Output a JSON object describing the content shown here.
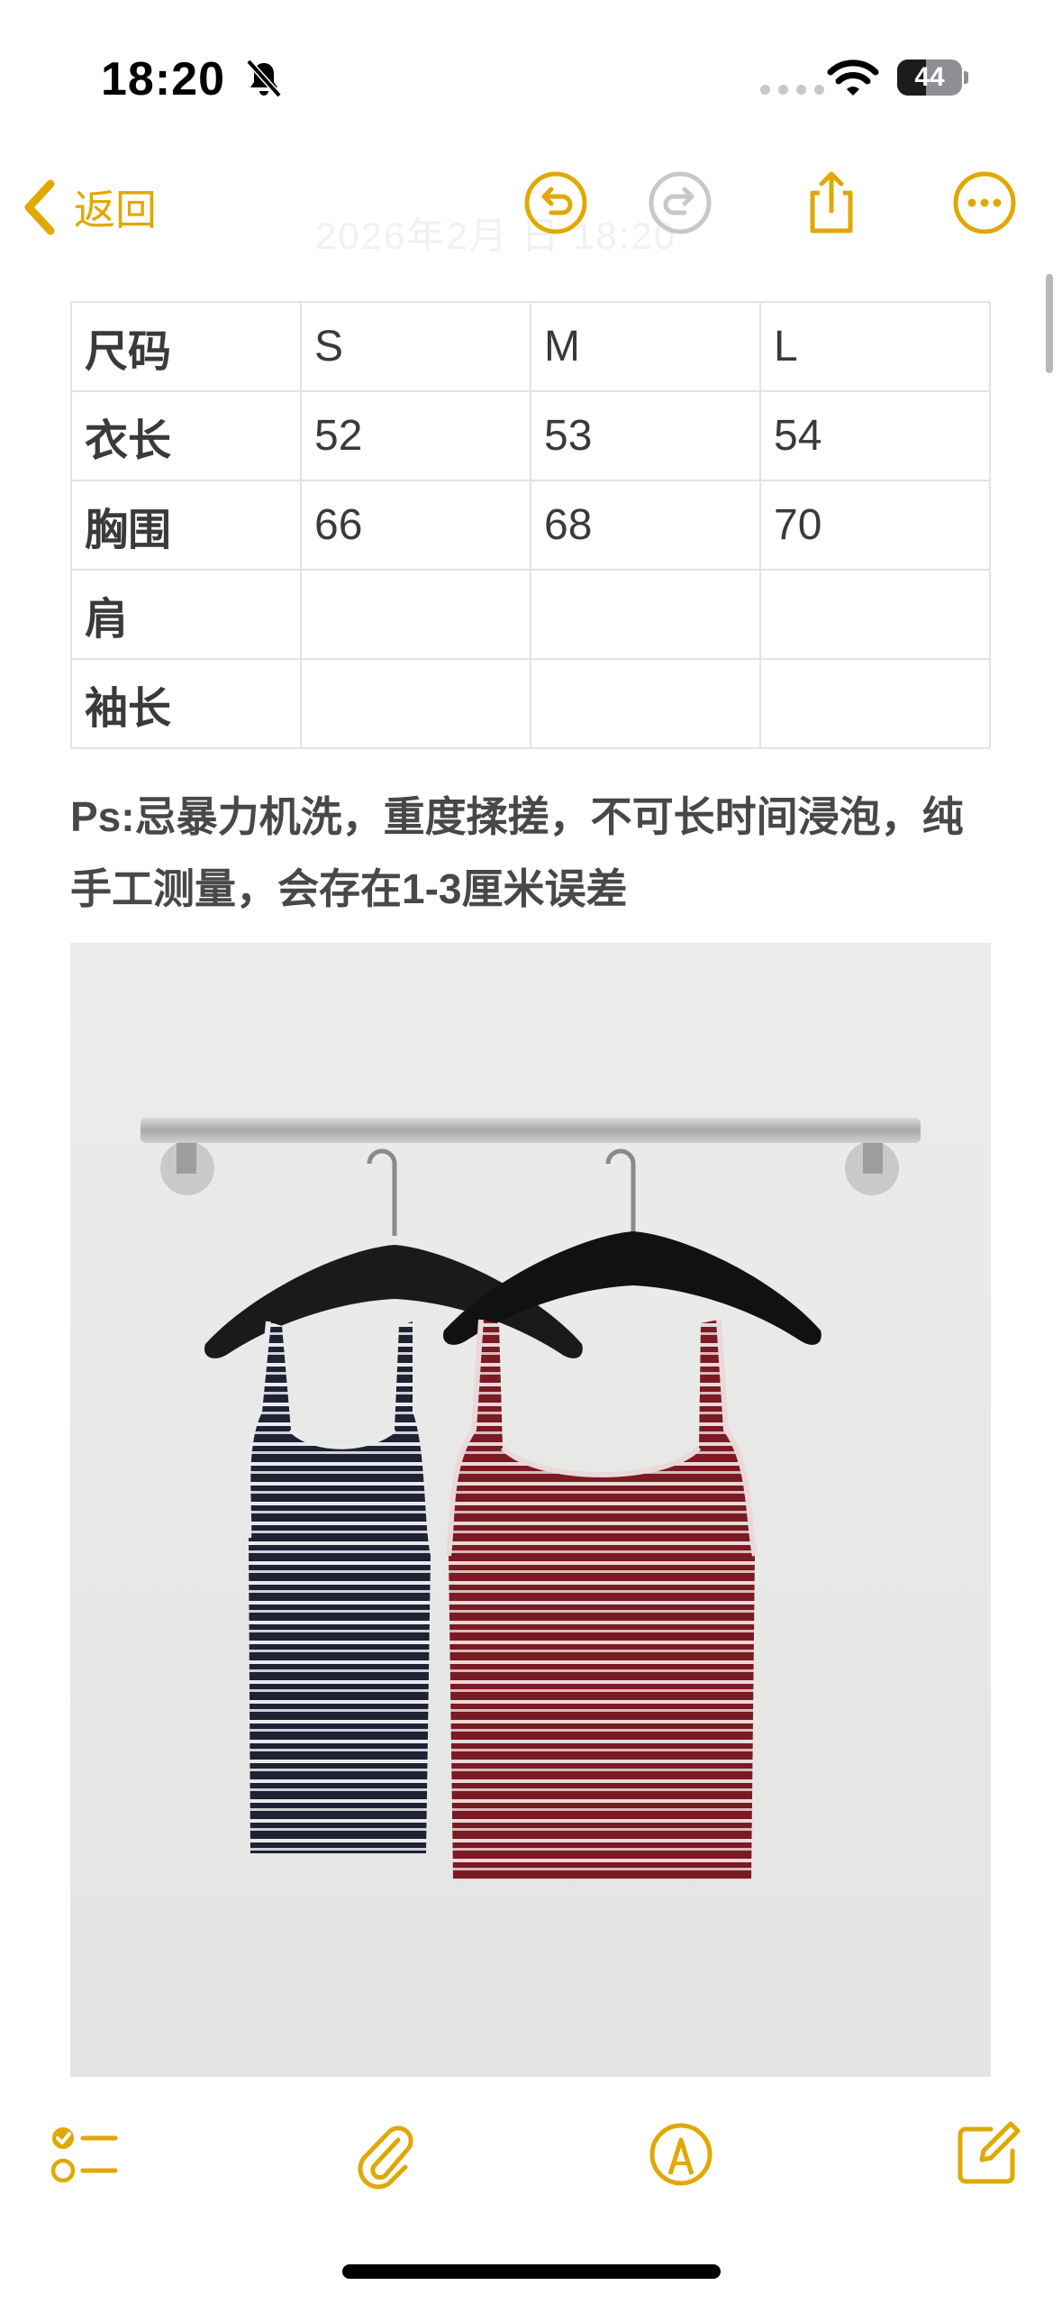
{
  "status_bar": {
    "time": "18:20",
    "battery_percent": "44",
    "battery_level": 0.44,
    "icons": [
      "bell-slash-icon",
      "cellular-dots-icon",
      "wifi-icon",
      "battery-icon"
    ]
  },
  "nav": {
    "back_label": "返回",
    "ghost_date": "2026年2月 日 18:20",
    "icons": [
      "undo-icon",
      "redo-icon",
      "share-icon",
      "more-icon"
    ]
  },
  "table": {
    "rows": [
      [
        "尺码",
        "S",
        "M",
        "L"
      ],
      [
        "衣长",
        "52",
        "53",
        "54"
      ],
      [
        "胸围",
        "66",
        "68",
        "70"
      ],
      [
        "肩",
        "",
        "",
        ""
      ],
      [
        "袖长",
        "",
        "",
        ""
      ]
    ]
  },
  "note": {
    "text": "Ps:忌暴力机洗，重度揉搓，不可长时间浸泡，纯手工测量，会存在1-3厘米误差"
  },
  "photo": {
    "description_icon": "striped-camisole-photo"
  },
  "toolbar": {
    "icons": [
      "checklist-icon",
      "attachment-icon",
      "markup-icon",
      "compose-icon"
    ]
  },
  "colors": {
    "accent": "#e0a800",
    "disabled": "#c7c7cc",
    "navy_stripe": "#1e2233",
    "burgundy_stripe": "#7a1a22"
  }
}
